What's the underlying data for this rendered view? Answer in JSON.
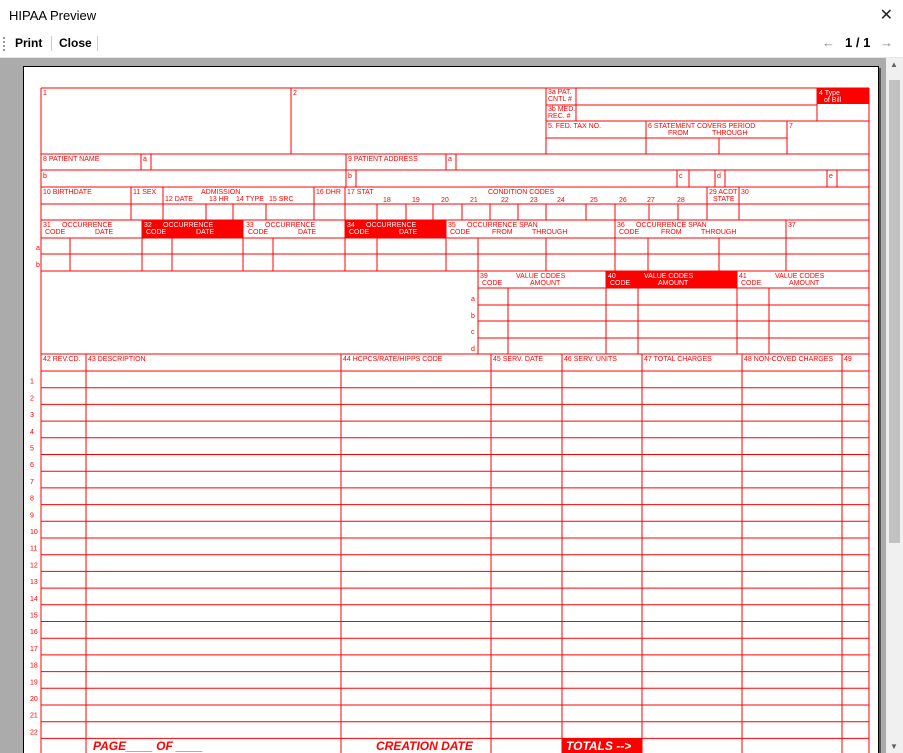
{
  "window": {
    "title": "HIPAA Preview",
    "close_glyph": "✕"
  },
  "toolbar": {
    "print_label": "Print",
    "close_label": "Close",
    "prev_glyph": "←",
    "next_glyph": "→",
    "page_indicator": "1 / 1"
  },
  "colors": {
    "form_red": "#ff0000",
    "bg_gray": "#ababab"
  },
  "form": {
    "header": {
      "f1": "1",
      "f2": "2",
      "f3a_line1": "3a PAT.",
      "f3a_line2": "CNTL #",
      "f3b_line1": "3b MED.",
      "f3b_line2": "REC. #",
      "f4_line1": "4  Type",
      "f4_line2": "of Bill",
      "f5": "5. FED. TAX NO.",
      "f6_line1": "6    STATEMENT COVERS PERIOD",
      "f6_from": "FROM",
      "f6_through": "THROUGH",
      "f7": "7"
    },
    "patient": {
      "f8": "8 PATIENT NAME",
      "f8a": "a",
      "f9": "9 PATIENT ADDRESS",
      "f9a": "a",
      "f8b": "b",
      "f9b": "b",
      "f9c": "c",
      "f9d": "d",
      "f9e": "e"
    },
    "admission": {
      "f10": "10 BIRTHDATE",
      "f11": "11 SEX",
      "admission": "ADMISSION",
      "f12": "12  DATE",
      "f13": "13 HR",
      "f14": "14 TYPE",
      "f15": "15 SRC",
      "f16": "16 DHR",
      "f17": "17 STAT",
      "condition": "CONDITION CODES",
      "cc_numbers": [
        "18",
        "19",
        "20",
        "21",
        "22",
        "23",
        "24",
        "25",
        "26",
        "27",
        "28"
      ],
      "f29": "29 ACDT",
      "f29b": "STATE",
      "f30": "30"
    },
    "occurrence": {
      "labels": [
        "31",
        "32",
        "33",
        "34"
      ],
      "occ": "OCCURRENCE",
      "code": "CODE",
      "date": "DATE",
      "span_labels": [
        "35",
        "36"
      ],
      "span": "OCCURRENCE SPAN",
      "from": "FROM",
      "through": "THROUGH",
      "f37": "37",
      "row_a": "a",
      "row_b": "b"
    },
    "value_codes": {
      "labels": [
        "39",
        "40",
        "41"
      ],
      "vc": "VALUE CODES",
      "code": "CODE",
      "amount": "AMOUNT",
      "rows": [
        "a",
        "b",
        "c",
        "d"
      ]
    },
    "lines": {
      "headers": [
        "42 REV.CD.",
        "43 DESCRIPTION",
        "44 HCPCS/RATE/HIPPS CODE",
        "45 SERV. DATE",
        "46 SERV. UNITS",
        "47 TOTAL CHARGES",
        "48 NON-COVED CHARGES",
        "49"
      ],
      "row_numbers": [
        "1",
        "2",
        "3",
        "4",
        "5",
        "6",
        "7",
        "8",
        "9",
        "10",
        "11",
        "12",
        "13",
        "14",
        "15",
        "16",
        "17",
        "18",
        "19",
        "20",
        "21",
        "22"
      ]
    },
    "footer": {
      "page": "PAGE____  OF ____",
      "creation": "CREATION DATE",
      "totals": "TOTALS -->"
    }
  }
}
